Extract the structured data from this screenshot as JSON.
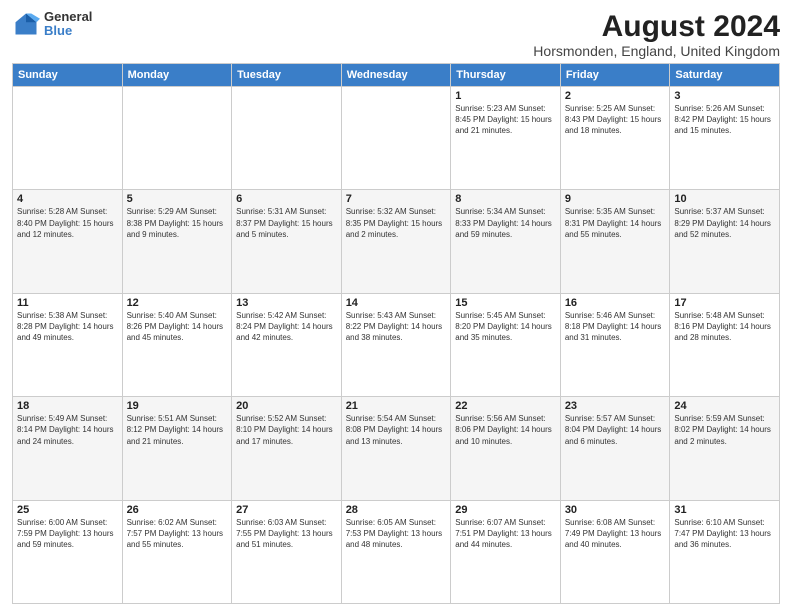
{
  "logo": {
    "general": "General",
    "blue": "Blue"
  },
  "title": "August 2024",
  "subtitle": "Horsmonden, England, United Kingdom",
  "weekdays": [
    "Sunday",
    "Monday",
    "Tuesday",
    "Wednesday",
    "Thursday",
    "Friday",
    "Saturday"
  ],
  "weeks": [
    [
      {
        "day": "",
        "info": ""
      },
      {
        "day": "",
        "info": ""
      },
      {
        "day": "",
        "info": ""
      },
      {
        "day": "",
        "info": ""
      },
      {
        "day": "1",
        "info": "Sunrise: 5:23 AM\nSunset: 8:45 PM\nDaylight: 15 hours\nand 21 minutes."
      },
      {
        "day": "2",
        "info": "Sunrise: 5:25 AM\nSunset: 8:43 PM\nDaylight: 15 hours\nand 18 minutes."
      },
      {
        "day": "3",
        "info": "Sunrise: 5:26 AM\nSunset: 8:42 PM\nDaylight: 15 hours\nand 15 minutes."
      }
    ],
    [
      {
        "day": "4",
        "info": "Sunrise: 5:28 AM\nSunset: 8:40 PM\nDaylight: 15 hours\nand 12 minutes."
      },
      {
        "day": "5",
        "info": "Sunrise: 5:29 AM\nSunset: 8:38 PM\nDaylight: 15 hours\nand 9 minutes."
      },
      {
        "day": "6",
        "info": "Sunrise: 5:31 AM\nSunset: 8:37 PM\nDaylight: 15 hours\nand 5 minutes."
      },
      {
        "day": "7",
        "info": "Sunrise: 5:32 AM\nSunset: 8:35 PM\nDaylight: 15 hours\nand 2 minutes."
      },
      {
        "day": "8",
        "info": "Sunrise: 5:34 AM\nSunset: 8:33 PM\nDaylight: 14 hours\nand 59 minutes."
      },
      {
        "day": "9",
        "info": "Sunrise: 5:35 AM\nSunset: 8:31 PM\nDaylight: 14 hours\nand 55 minutes."
      },
      {
        "day": "10",
        "info": "Sunrise: 5:37 AM\nSunset: 8:29 PM\nDaylight: 14 hours\nand 52 minutes."
      }
    ],
    [
      {
        "day": "11",
        "info": "Sunrise: 5:38 AM\nSunset: 8:28 PM\nDaylight: 14 hours\nand 49 minutes."
      },
      {
        "day": "12",
        "info": "Sunrise: 5:40 AM\nSunset: 8:26 PM\nDaylight: 14 hours\nand 45 minutes."
      },
      {
        "day": "13",
        "info": "Sunrise: 5:42 AM\nSunset: 8:24 PM\nDaylight: 14 hours\nand 42 minutes."
      },
      {
        "day": "14",
        "info": "Sunrise: 5:43 AM\nSunset: 8:22 PM\nDaylight: 14 hours\nand 38 minutes."
      },
      {
        "day": "15",
        "info": "Sunrise: 5:45 AM\nSunset: 8:20 PM\nDaylight: 14 hours\nand 35 minutes."
      },
      {
        "day": "16",
        "info": "Sunrise: 5:46 AM\nSunset: 8:18 PM\nDaylight: 14 hours\nand 31 minutes."
      },
      {
        "day": "17",
        "info": "Sunrise: 5:48 AM\nSunset: 8:16 PM\nDaylight: 14 hours\nand 28 minutes."
      }
    ],
    [
      {
        "day": "18",
        "info": "Sunrise: 5:49 AM\nSunset: 8:14 PM\nDaylight: 14 hours\nand 24 minutes."
      },
      {
        "day": "19",
        "info": "Sunrise: 5:51 AM\nSunset: 8:12 PM\nDaylight: 14 hours\nand 21 minutes."
      },
      {
        "day": "20",
        "info": "Sunrise: 5:52 AM\nSunset: 8:10 PM\nDaylight: 14 hours\nand 17 minutes."
      },
      {
        "day": "21",
        "info": "Sunrise: 5:54 AM\nSunset: 8:08 PM\nDaylight: 14 hours\nand 13 minutes."
      },
      {
        "day": "22",
        "info": "Sunrise: 5:56 AM\nSunset: 8:06 PM\nDaylight: 14 hours\nand 10 minutes."
      },
      {
        "day": "23",
        "info": "Sunrise: 5:57 AM\nSunset: 8:04 PM\nDaylight: 14 hours\nand 6 minutes."
      },
      {
        "day": "24",
        "info": "Sunrise: 5:59 AM\nSunset: 8:02 PM\nDaylight: 14 hours\nand 2 minutes."
      }
    ],
    [
      {
        "day": "25",
        "info": "Sunrise: 6:00 AM\nSunset: 7:59 PM\nDaylight: 13 hours\nand 59 minutes."
      },
      {
        "day": "26",
        "info": "Sunrise: 6:02 AM\nSunset: 7:57 PM\nDaylight: 13 hours\nand 55 minutes."
      },
      {
        "day": "27",
        "info": "Sunrise: 6:03 AM\nSunset: 7:55 PM\nDaylight: 13 hours\nand 51 minutes."
      },
      {
        "day": "28",
        "info": "Sunrise: 6:05 AM\nSunset: 7:53 PM\nDaylight: 13 hours\nand 48 minutes."
      },
      {
        "day": "29",
        "info": "Sunrise: 6:07 AM\nSunset: 7:51 PM\nDaylight: 13 hours\nand 44 minutes."
      },
      {
        "day": "30",
        "info": "Sunrise: 6:08 AM\nSunset: 7:49 PM\nDaylight: 13 hours\nand 40 minutes."
      },
      {
        "day": "31",
        "info": "Sunrise: 6:10 AM\nSunset: 7:47 PM\nDaylight: 13 hours\nand 36 minutes."
      }
    ]
  ]
}
